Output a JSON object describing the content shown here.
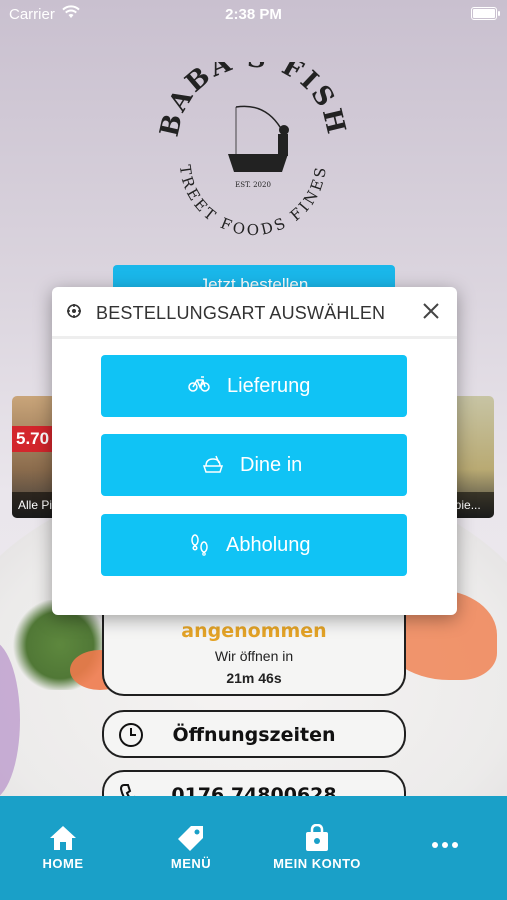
{
  "status_bar": {
    "carrier": "Carrier",
    "time": "2:38 PM"
  },
  "logo": {
    "top_text": "BABA'S FISH",
    "bottom_text": "STREET FOODS FINEST",
    "est": "EST. 2020"
  },
  "order_bar": {
    "label": "Jetzt bestellen"
  },
  "side_cards": {
    "left": {
      "price": "5.70",
      "caption": "Alle Pi"
    },
    "right": {
      "caption": "ppie..."
    }
  },
  "info": {
    "status": "angenommen",
    "open_text": "Wir öffnen in",
    "countdown": "21m 46s",
    "hours_label": "Öffnungszeiten",
    "phone": "0176 74800628"
  },
  "modal": {
    "title": "BESTELLUNGSART AUSWÄHLEN",
    "options": [
      {
        "label": "Lieferung",
        "icon": "bicycle-icon"
      },
      {
        "label": "Dine in",
        "icon": "dine-in-icon"
      },
      {
        "label": "Abholung",
        "icon": "footsteps-icon"
      }
    ]
  },
  "tabbar": {
    "home": "HOME",
    "menu": "MENÜ",
    "account": "MEIN KONTO"
  },
  "colors": {
    "accent": "#10c3f5",
    "tabbar": "#1aa0c8",
    "status_orange": "#e4a326"
  }
}
